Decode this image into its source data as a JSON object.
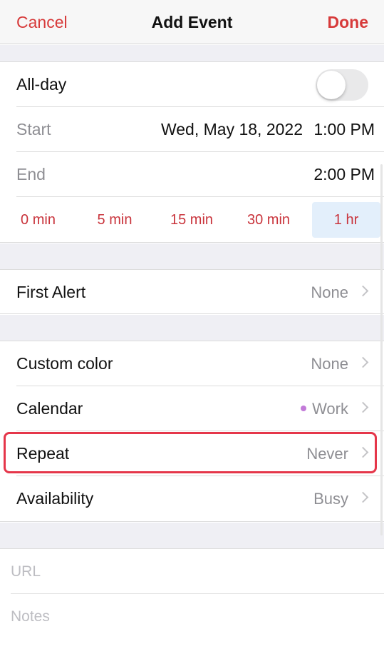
{
  "nav": {
    "cancel_label": "Cancel",
    "title": "Add Event",
    "done_label": "Done"
  },
  "event": {
    "allday_label": "All-day",
    "allday_on": false,
    "start_label": "Start",
    "start_date": "Wed, May 18, 2022",
    "start_time": "1:00 PM",
    "end_label": "End",
    "end_time": "2:00 PM",
    "durations": [
      "0 min",
      "5 min",
      "15 min",
      "30 min",
      "1 hr"
    ],
    "selected_duration": "1 hr"
  },
  "alert": {
    "label": "First Alert",
    "value": "None"
  },
  "options": {
    "custom_color_label": "Custom color",
    "custom_color_value": "None",
    "calendar_label": "Calendar",
    "calendar_value": "Work",
    "calendar_color": "#c27ad8",
    "repeat_label": "Repeat",
    "repeat_value": "Never",
    "availability_label": "Availability",
    "availability_value": "Busy"
  },
  "notes": {
    "url_placeholder": "URL",
    "notes_placeholder": "Notes"
  },
  "colors": {
    "accent": "#d73a3a",
    "highlight": "#e5364a"
  }
}
